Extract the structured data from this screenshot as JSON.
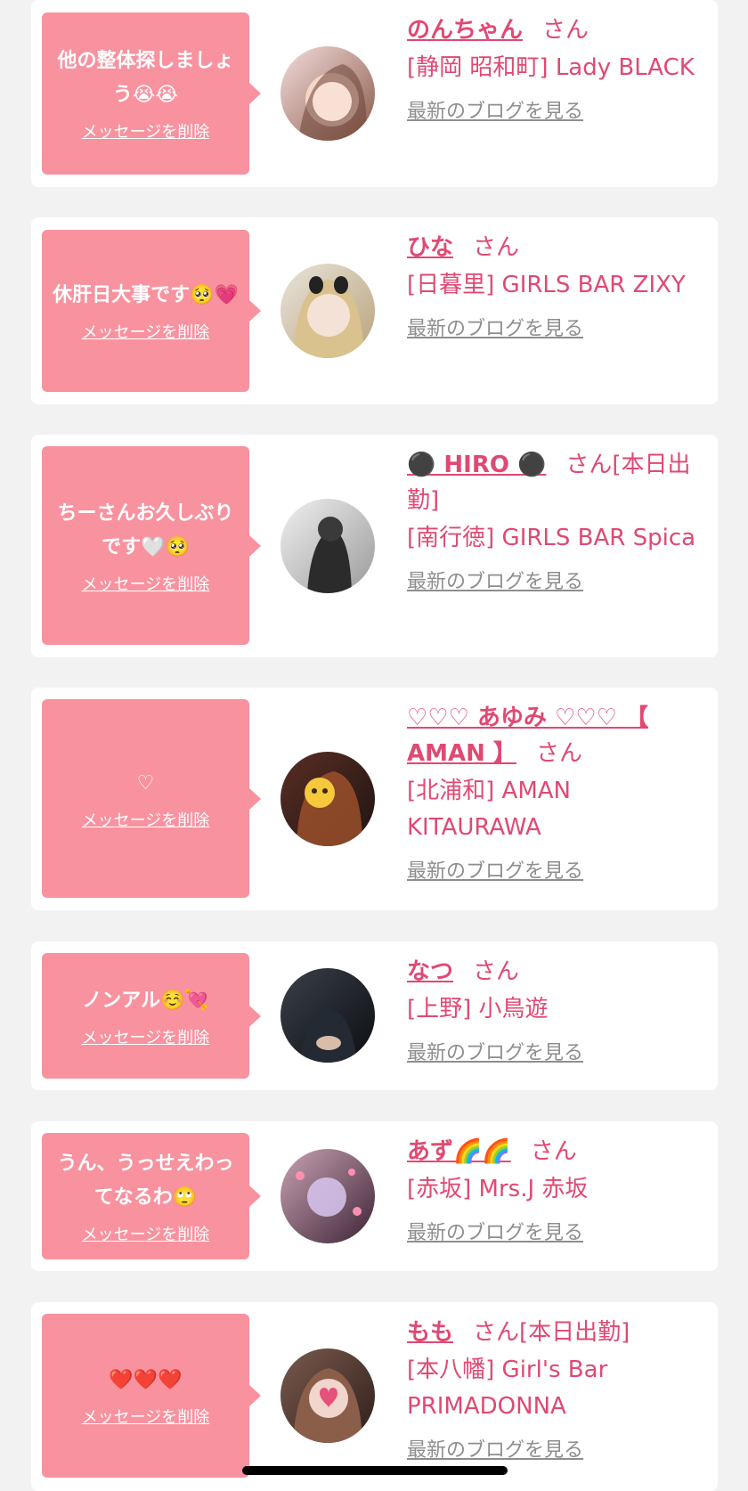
{
  "colors": {
    "background": "#f2f2f2",
    "card": "#ffffff",
    "bubble": "#f8929f",
    "accent": "#e04972",
    "muted": "#8e8e8e"
  },
  "delete_label": "メッセージを削除",
  "blog_label": "最新のブログを見る",
  "messages": [
    {
      "message": "他の整体探しましょう😭😭",
      "name": "のんちゃん",
      "suffix": "さん",
      "shop": "[静岡 昭和町] Lady BLACK",
      "avatar_icon": "profile-photo"
    },
    {
      "message": "休肝日大事です🥺💗",
      "name": "ひな",
      "suffix": "さん",
      "shop": "[日暮里] GIRLS BAR ZIXY",
      "avatar_icon": "profile-photo"
    },
    {
      "message": "ちーさんお久しぶりです🤍🥺",
      "name": "⚫️ HIRO ⚫️",
      "suffix": "さん[本日出勤]",
      "shop": "[南行徳] GIRLS BAR Spica",
      "avatar_icon": "profile-photo"
    },
    {
      "message": "♡",
      "name": "♡♡♡ あゆみ ♡♡♡ 【 AMAN 】",
      "suffix": "さん",
      "shop": "[北浦和] AMAN KITAURAWA",
      "avatar_icon": "profile-photo"
    },
    {
      "message": "ノンアル☺️💘",
      "name": "なつ",
      "suffix": "さん",
      "shop": "[上野] 小鳥遊",
      "avatar_icon": "profile-photo"
    },
    {
      "message": "うん、うっせえわってなるわ🙄",
      "name": "あず🌈🌈",
      "suffix": "さん",
      "shop": "[赤坂] Mrs.J 赤坂",
      "avatar_icon": "profile-photo"
    },
    {
      "message": "❤️❤️❤️",
      "name": "もも",
      "suffix": "さん[本日出勤]",
      "shop": "[本八幡] Girl's Bar PRIMADONNA",
      "avatar_icon": "profile-photo"
    }
  ]
}
